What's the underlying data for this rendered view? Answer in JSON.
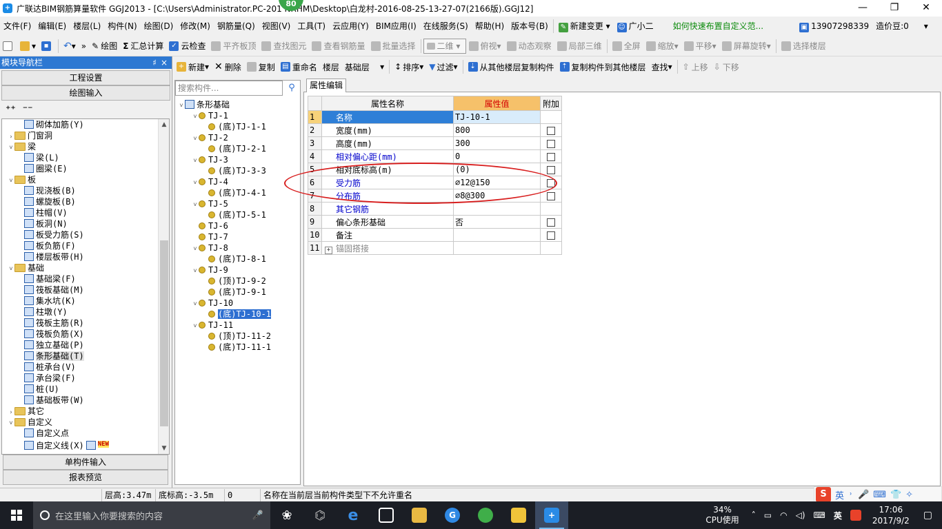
{
  "title": {
    "text": "广联达BIM钢筋算量软件 GGJ2013 - [C:\\Users\\Administrator.PC-201   NRHM\\Desktop\\白龙村-2016-08-25-13-27-07(2166版).GGJ12]",
    "badge": "80",
    "minimize": "—",
    "restore": "❐",
    "close": "✕"
  },
  "menu": {
    "items": [
      "文件(F)",
      "编辑(E)",
      "楼层(L)",
      "构件(N)",
      "绘图(D)",
      "修改(M)",
      "钢筋量(Q)",
      "视图(V)",
      "工具(T)",
      "云应用(Y)",
      "BIM应用(I)",
      "在线服务(S)",
      "帮助(H)",
      "版本号(B)"
    ],
    "new_change": "新建变更",
    "assistant": "广小二",
    "help_link": "如何快速布置自定义范...",
    "phone": "13907298339",
    "coins": "造价豆:0"
  },
  "toolbar": {
    "draw": "绘图",
    "sum": "汇总计算",
    "cloud_check": "云检查",
    "align_slab": "平齐板顶",
    "find_element": "查找图元",
    "view_rebar": "查看钢筋量",
    "batch_select": "批量选择",
    "view_mode": "二维",
    "top_view": "俯视",
    "dynamic_view": "动态观察",
    "local_3d": "局部三维",
    "fullscreen": "全屏",
    "zoom": "缩放",
    "pan": "平移",
    "rotate": "屏幕旋转",
    "select_floor": "选择楼层"
  },
  "toolbar2": {
    "new": "新建",
    "delete": "删除",
    "copy": "复制",
    "rename": "重命名",
    "floor_label": "楼层",
    "floor_value": "基础层",
    "sort": "排序",
    "filter": "过滤",
    "copy_from": "从其他楼层复制构件",
    "copy_to": "复制构件到其他楼层",
    "find": "查找",
    "move_up": "上移",
    "move_down": "下移"
  },
  "left": {
    "header": "模块导航栏",
    "pin": "♯",
    "close": "×",
    "project_settings": "工程设置",
    "drawing_input": "绘图输入",
    "tree": [
      {
        "level": 2,
        "type": "item",
        "label": "砌体加筋(Y)"
      },
      {
        "level": 1,
        "type": "folder",
        "expand": "›",
        "label": "门窗洞"
      },
      {
        "level": 1,
        "type": "folder",
        "expand": "˅",
        "label": "梁"
      },
      {
        "level": 2,
        "type": "item",
        "label": "梁(L)"
      },
      {
        "level": 2,
        "type": "item",
        "label": "圈梁(E)"
      },
      {
        "level": 1,
        "type": "folder",
        "expand": "˅",
        "label": "板"
      },
      {
        "level": 2,
        "type": "item",
        "label": "现浇板(B)"
      },
      {
        "level": 2,
        "type": "item",
        "label": "螺旋板(B)"
      },
      {
        "level": 2,
        "type": "item",
        "label": "柱帽(V)"
      },
      {
        "level": 2,
        "type": "item",
        "label": "板洞(N)"
      },
      {
        "level": 2,
        "type": "item",
        "label": "板受力筋(S)"
      },
      {
        "level": 2,
        "type": "item",
        "label": "板负筋(F)"
      },
      {
        "level": 2,
        "type": "item",
        "label": "楼层板带(H)"
      },
      {
        "level": 1,
        "type": "folder",
        "expand": "˅",
        "label": "基础"
      },
      {
        "level": 2,
        "type": "item",
        "label": "基础梁(F)"
      },
      {
        "level": 2,
        "type": "item",
        "label": "筏板基础(M)"
      },
      {
        "level": 2,
        "type": "item",
        "label": "集水坑(K)"
      },
      {
        "level": 2,
        "type": "item",
        "label": "柱墩(Y)"
      },
      {
        "level": 2,
        "type": "item",
        "label": "筏板主筋(R)"
      },
      {
        "level": 2,
        "type": "item",
        "label": "筏板负筋(X)"
      },
      {
        "level": 2,
        "type": "item",
        "label": "独立基础(P)"
      },
      {
        "level": 2,
        "type": "item",
        "label": "条形基础(T)",
        "selected": true
      },
      {
        "level": 2,
        "type": "item",
        "label": "桩承台(V)"
      },
      {
        "level": 2,
        "type": "item",
        "label": "承台梁(F)"
      },
      {
        "level": 2,
        "type": "item",
        "label": "桩(U)"
      },
      {
        "level": 2,
        "type": "item",
        "label": "基础板带(W)"
      },
      {
        "level": 1,
        "type": "folder",
        "expand": "›",
        "label": "其它"
      },
      {
        "level": 1,
        "type": "folder",
        "expand": "˅",
        "label": "自定义"
      },
      {
        "level": 2,
        "type": "item",
        "label": "自定义点"
      },
      {
        "level": 2,
        "type": "item",
        "label": "自定义线(X)",
        "new": "NEW"
      }
    ],
    "single_input": "单构件输入",
    "report_preview": "报表预览"
  },
  "middle": {
    "search_placeholder": "搜索构件...",
    "root": "条形基础",
    "tree": [
      {
        "level": 1,
        "expand": "˅",
        "label": "TJ-1"
      },
      {
        "level": 2,
        "label": "(底)TJ-1-1"
      },
      {
        "level": 1,
        "expand": "˅",
        "label": "TJ-2"
      },
      {
        "level": 2,
        "label": "(底)TJ-2-1"
      },
      {
        "level": 1,
        "expand": "˅",
        "label": "TJ-3"
      },
      {
        "level": 2,
        "label": "(底)TJ-3-3"
      },
      {
        "level": 1,
        "expand": "˅",
        "label": "TJ-4"
      },
      {
        "level": 2,
        "label": "(底)TJ-4-1"
      },
      {
        "level": 1,
        "expand": "˅",
        "label": "TJ-5"
      },
      {
        "level": 2,
        "label": "(底)TJ-5-1"
      },
      {
        "level": 1,
        "expand": "",
        "label": "TJ-6"
      },
      {
        "level": 1,
        "expand": "",
        "label": "TJ-7"
      },
      {
        "level": 1,
        "expand": "˅",
        "label": "TJ-8"
      },
      {
        "level": 2,
        "label": "(底)TJ-8-1"
      },
      {
        "level": 1,
        "expand": "˅",
        "label": "TJ-9"
      },
      {
        "level": 2,
        "label": "(顶)TJ-9-2"
      },
      {
        "level": 2,
        "label": "(底)TJ-9-1"
      },
      {
        "level": 1,
        "expand": "˅",
        "label": "TJ-10"
      },
      {
        "level": 2,
        "label": "(底)TJ-10-1",
        "selected": true
      },
      {
        "level": 1,
        "expand": "˅",
        "label": "TJ-11"
      },
      {
        "level": 2,
        "label": "(顶)TJ-11-2"
      },
      {
        "level": 2,
        "label": "(底)TJ-11-1"
      }
    ]
  },
  "props": {
    "tab": "属性编辑",
    "headers": [
      "属性名称",
      "属性值",
      "附加"
    ],
    "rows": [
      {
        "n": "1",
        "name": "名称",
        "value": "TJ-10-1",
        "style": "selected",
        "check": false
      },
      {
        "n": "2",
        "name": "宽度(mm)",
        "value": "800",
        "style": "normal",
        "check": true
      },
      {
        "n": "3",
        "name": "高度(mm)",
        "value": "300",
        "style": "normal",
        "check": true
      },
      {
        "n": "4",
        "name": "相对偏心距(mm)",
        "value": "0",
        "style": "blue",
        "check": true
      },
      {
        "n": "5",
        "name": "相对底标高(m)",
        "value": "(0)",
        "style": "normal",
        "check": true
      },
      {
        "n": "6",
        "name": "受力筋",
        "value": "⌀12@150",
        "style": "blue",
        "check": true
      },
      {
        "n": "7",
        "name": "分布筋",
        "value": "⌀8@300",
        "style": "blue",
        "check": true
      },
      {
        "n": "8",
        "name": "其它钢筋",
        "value": "",
        "style": "blue",
        "check": false
      },
      {
        "n": "9",
        "name": "偏心条形基础",
        "value": "否",
        "style": "normal",
        "check": true
      },
      {
        "n": "10",
        "name": "备注",
        "value": "",
        "style": "normal",
        "check": true
      },
      {
        "n": "11",
        "name": "锚固搭接",
        "value": "",
        "style": "gray",
        "check": false,
        "plus": "+"
      }
    ]
  },
  "status": {
    "floor_height": "层高:3.47m",
    "bottom_elev": "底标高:-3.5m",
    "zero": "0",
    "message": "名称在当前层当前构件类型下不允许重名"
  },
  "ime": {
    "lang": "英",
    "punct": "˒",
    "mic": "🎤",
    "kbd": "⌨",
    "shirt": "👕",
    "tools": "✧"
  },
  "taskbar": {
    "search_placeholder": "在这里输入你要搜索的内容",
    "cpu_percent": "34%",
    "cpu_label": "CPU使用",
    "lang": "英",
    "time": "17:06",
    "date": "2017/9/2",
    "colors": {
      "bg": "#1b1e25",
      "active": "#3b4a63",
      "accent": "#76b9ed"
    }
  }
}
